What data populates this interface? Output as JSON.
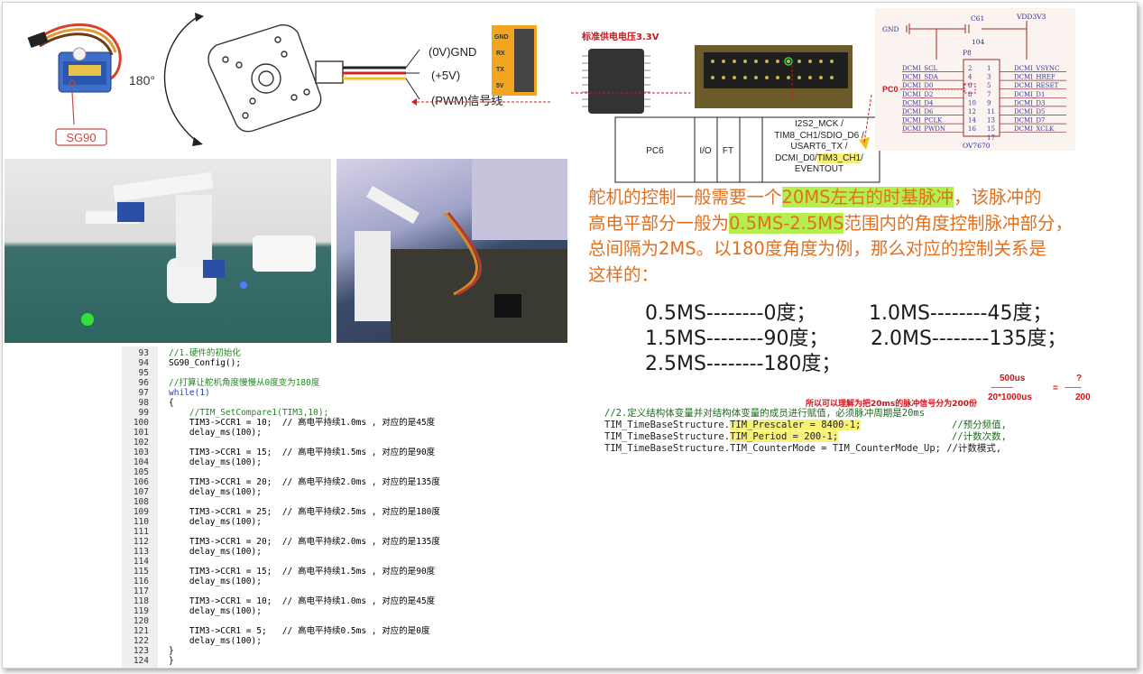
{
  "servo_diagram": {
    "model_label": "SG90",
    "angle_label": "180°",
    "wire_gnd": "(0V)GND",
    "wire_vcc": "(+5V)",
    "wire_pwm": "(PWM)信号线",
    "header_pins": [
      "GND",
      "RX",
      "TX",
      "5V"
    ]
  },
  "chip": {
    "label": "标准供电电压3.3V"
  },
  "pin_table": {
    "pin": "PC6",
    "io": "I/O",
    "ft": "FT",
    "functions": "I2S2_MCK /\nTIM8_CH1/SDIO_D6 /\nUSART6_TX /\nDCMI_D0/",
    "highlight": "TIM3_CH1",
    "tail": "/\nEVENTOUT"
  },
  "schematic": {
    "gnd": "GND",
    "cap_name": "C61",
    "cap_value": "104",
    "vdd": "VDD3V3",
    "connector": "P8",
    "chip_name": "OV7670",
    "pc0": "PC0",
    "left_nets": [
      "DCMI_SCL",
      "DCMI_SDA",
      "DCMI_D0",
      "DCMI_D2",
      "DCMI_D4",
      "DCMI_D6",
      "DCMI_PCLK",
      "DCMI_PWDN"
    ],
    "left_pins": [
      "2",
      "4",
      "6",
      "8",
      "10",
      "12",
      "14",
      "16"
    ],
    "right_pins": [
      "1",
      "3",
      "5",
      "7",
      "9",
      "11",
      "13",
      "15",
      "17"
    ],
    "right_nets": [
      "DCMI_VSYNC",
      "DCMI_HREF",
      "DCMI_RESET",
      "DCMI_D1",
      "DCMI_D3",
      "DCMI_D5",
      "DCMI_D7",
      "DCMI_XCLK"
    ]
  },
  "explanation": {
    "line1_a": "舵机的控制一般需要一个",
    "line1_hl": "20MS左右的时基脉冲",
    "line1_b": "，该脉冲的",
    "line2_a": "高电平部分一般为",
    "line2_hl": "0.5MS-2.5MS",
    "line2_b": "范围内的角度控制脉冲部分，",
    "line3": "总间隔为2MS。以180度角度为例，那么对应的控制关系是",
    "line4": "这样的："
  },
  "relations": [
    {
      "left": "0.5MS--------0度；",
      "right": "1.0MS--------45度；"
    },
    {
      "left": "1.5MS--------90度；",
      "right": "2.0MS--------135度；"
    },
    {
      "left": "2.5MS--------180度；",
      "right": ""
    }
  ],
  "ratio": {
    "top_left": "500us",
    "bottom_left": "20*1000us",
    "eq": "=",
    "top_right": "?",
    "bottom_right": "200",
    "dashes": "------------",
    "dashes_short": "---------"
  },
  "note": "所以可以理解为把20ms的脉冲信号分为200份",
  "timer_config": {
    "comment": "//2.定义结构体变量并对结构体变量的成员进行赋值，必须脉冲周期是20ms",
    "l1_prefix": "TIM_TimeBaseStructure.",
    "l1_hl": "TIM_Prescaler = 8400-1;",
    "l1_cmt": "//预分频值,",
    "l2_prefix": "TIM_TimeBaseStructure.",
    "l2_hl": "TIM_Period = 200-1;",
    "l2_cmt": "//计数次数,",
    "l3": "TIM_TimeBaseStructure.TIM_CounterMode = TIM_CounterMode_Up; //计数模式,"
  },
  "code_lines": [
    {
      "n": "93",
      "t": "//1.硬件的初始化",
      "k": "cmt"
    },
    {
      "n": "94",
      "t": "SG90_Config();",
      "k": ""
    },
    {
      "n": "95",
      "t": "",
      "k": ""
    },
    {
      "n": "96",
      "t": "//打算让舵机角度慢慢从0度变为180度",
      "k": "cmt"
    },
    {
      "n": "97",
      "t": "while(1)",
      "k": "kw"
    },
    {
      "n": "98",
      "t": "{",
      "k": ""
    },
    {
      "n": "99",
      "t": "    //TIM_SetCompare1(TIM3,10);",
      "k": "cmt"
    },
    {
      "n": "100",
      "t": "    TIM3->CCR1 = 10;  // 高电平持续1.0ms , 对应的是45度",
      "k": "mix"
    },
    {
      "n": "101",
      "t": "    delay_ms(100);",
      "k": ""
    },
    {
      "n": "102",
      "t": "",
      "k": ""
    },
    {
      "n": "103",
      "t": "    TIM3->CCR1 = 15;  // 高电平持续1.5ms , 对应的是90度",
      "k": "mix"
    },
    {
      "n": "104",
      "t": "    delay_ms(100);",
      "k": ""
    },
    {
      "n": "105",
      "t": "",
      "k": ""
    },
    {
      "n": "106",
      "t": "    TIM3->CCR1 = 20;  // 高电平持续2.0ms , 对应的是135度",
      "k": "mix"
    },
    {
      "n": "107",
      "t": "    delay_ms(100);",
      "k": ""
    },
    {
      "n": "108",
      "t": "",
      "k": ""
    },
    {
      "n": "109",
      "t": "    TIM3->CCR1 = 25;  // 高电平持续2.5ms , 对应的是180度",
      "k": "mix"
    },
    {
      "n": "110",
      "t": "    delay_ms(100);",
      "k": ""
    },
    {
      "n": "111",
      "t": "",
      "k": ""
    },
    {
      "n": "112",
      "t": "    TIM3->CCR1 = 20;  // 高电平持续2.0ms , 对应的是135度",
      "k": "mix"
    },
    {
      "n": "113",
      "t": "    delay_ms(100);",
      "k": ""
    },
    {
      "n": "114",
      "t": "",
      "k": ""
    },
    {
      "n": "115",
      "t": "    TIM3->CCR1 = 15;  // 高电平持续1.5ms , 对应的是90度",
      "k": "mix"
    },
    {
      "n": "116",
      "t": "    delay_ms(100);",
      "k": ""
    },
    {
      "n": "117",
      "t": "",
      "k": ""
    },
    {
      "n": "118",
      "t": "    TIM3->CCR1 = 10;  // 高电平持续1.0ms , 对应的是45度",
      "k": "mix"
    },
    {
      "n": "119",
      "t": "    delay_ms(100);",
      "k": ""
    },
    {
      "n": "120",
      "t": "",
      "k": ""
    },
    {
      "n": "121",
      "t": "    TIM3->CCR1 = 5;   // 高电平持续0.5ms , 对应的是0度",
      "k": "mix"
    },
    {
      "n": "122",
      "t": "    delay_ms(100);",
      "k": ""
    },
    {
      "n": "123",
      "t": "}",
      "k": ""
    },
    {
      "n": "124",
      "t": "}",
      "k": ""
    }
  ]
}
